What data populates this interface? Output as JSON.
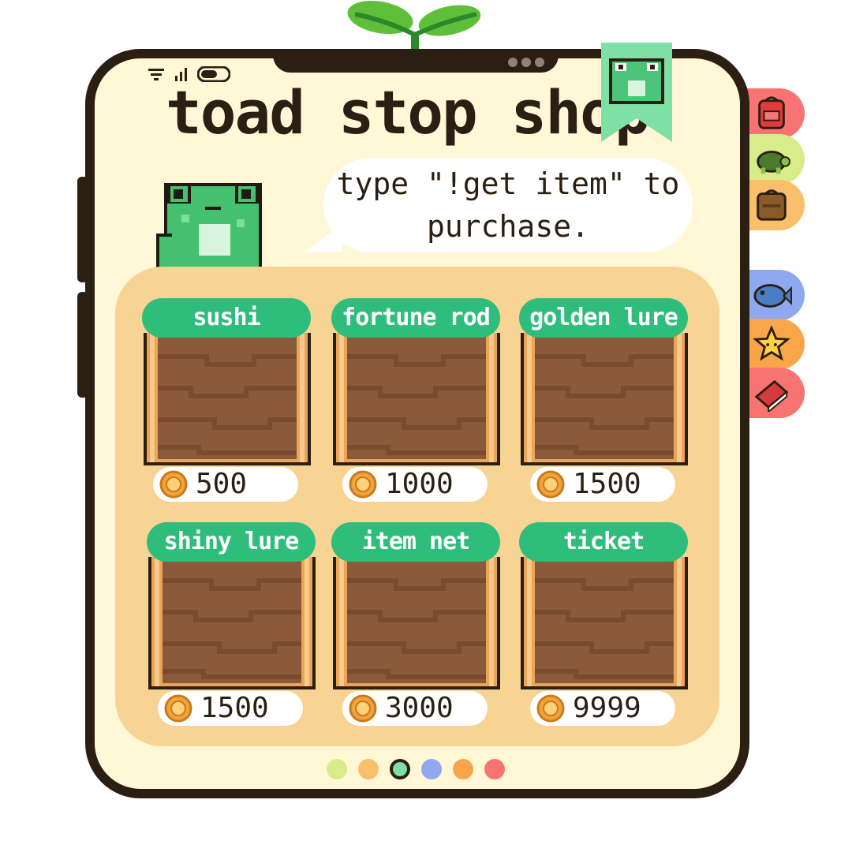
{
  "app": {
    "title": "toad stop shop"
  },
  "speech": {
    "text": "type \"!get item\" to\npurchase."
  },
  "items": [
    {
      "name": "sushi",
      "price": "500"
    },
    {
      "name": "fortune rod",
      "price": "1000"
    },
    {
      "name": "golden lure",
      "price": "1500"
    },
    {
      "name": "shiny lure",
      "price": "1500"
    },
    {
      "name": "item net",
      "price": "3000"
    },
    {
      "name": "ticket",
      "price": "9999"
    }
  ],
  "pager": {
    "active_index": 2,
    "colors": [
      "#d8ec8a",
      "#f9bf6b",
      "#7fe0a5",
      "#8fa9f0",
      "#f9a64a",
      "#f77472"
    ]
  },
  "side_tabs": [
    {
      "icon": "backpack-icon",
      "color": "#f77472"
    },
    {
      "icon": "turtle-icon",
      "color": "#d8ec8a"
    },
    {
      "icon": "bag-icon",
      "color": "#f9bf6b"
    },
    {
      "icon": "fish-icon",
      "color": "#8fa9f0"
    },
    {
      "icon": "star-icon",
      "color": "#f9a64a"
    },
    {
      "icon": "book-icon",
      "color": "#f77472"
    }
  ],
  "colors": {
    "accent_green": "#2fbd7c",
    "panel": "#f7d493",
    "screen": "#fff7d6",
    "frame": "#2b1e12"
  }
}
